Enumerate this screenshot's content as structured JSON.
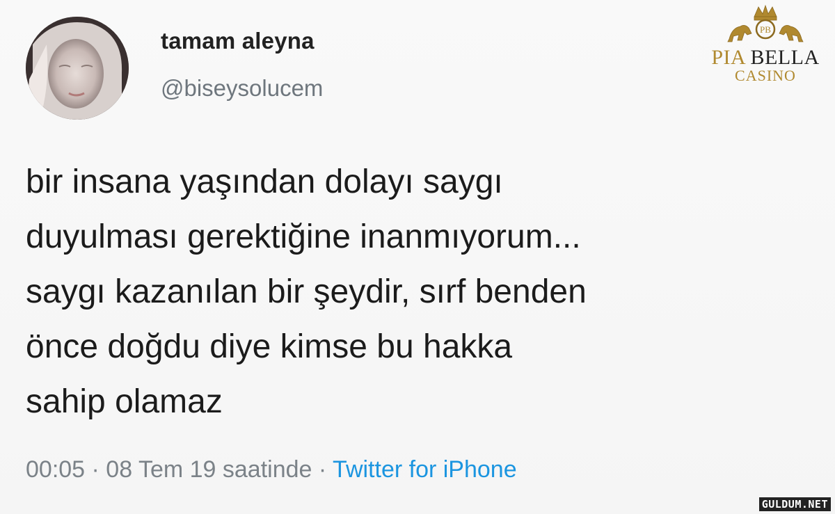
{
  "user": {
    "display_name": "tamam aleyna",
    "handle": "@biseysolucem",
    "avatar_icon": "profile-photo"
  },
  "tweet": {
    "lines": [
      "bir insana yaşından dolayı saygı",
      "duyulması gerektiğine inanmıyorum...",
      "saygı kazanılan bir şeydir, sırf benden",
      "önce doğdu diye kimse bu hakka",
      "sahip olamaz"
    ]
  },
  "meta": {
    "timestamp": "00:05 · 08 Tem 19 saatinde · ",
    "source": "Twitter for iPhone"
  },
  "brand": {
    "monogram": "PB",
    "name_part1": "PIA ",
    "name_part2": "BELLA",
    "subtitle": "CASINO",
    "gold": "#b0892f"
  },
  "watermark": "GULDUM.NET",
  "colors": {
    "link": "#1b95e0",
    "muted": "#6e767d"
  }
}
